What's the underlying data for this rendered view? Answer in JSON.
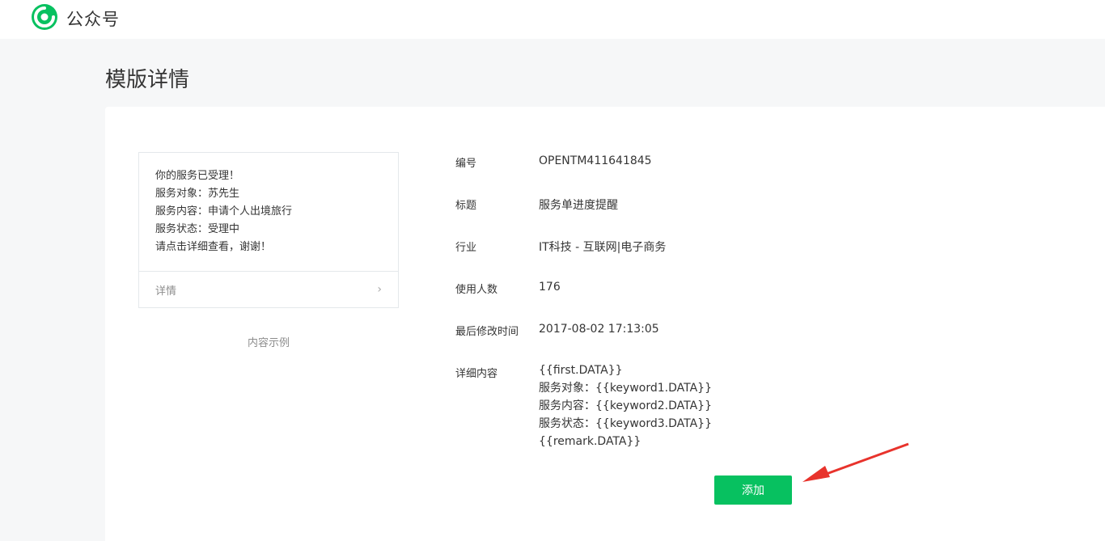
{
  "header": {
    "app_title": "公众号",
    "brand_color": "#07c160"
  },
  "page": {
    "title": "模版详情"
  },
  "sample": {
    "lines": [
      "你的服务已受理！",
      "服务对象：苏先生",
      "服务内容：申请个人出境旅行",
      "服务状态：受理中",
      "请点击详细查看，谢谢！"
    ],
    "detail_label": "详情",
    "chevron": "›",
    "caption": "内容示例"
  },
  "info": {
    "id_label": "编号",
    "id_value": "OPENTM411641845",
    "title_label": "标题",
    "title_value": "服务单进度提醒",
    "industry_label": "行业",
    "industry_value": "IT科技 - 互联网|电子商务",
    "users_label": "使用人数",
    "users_value": "176",
    "modified_label": "最后修改时间",
    "modified_value": "2017-08-02 17:13:05",
    "detail_label": "详细内容",
    "detail_lines": [
      "{{first.DATA}}",
      "服务对象：{{keyword1.DATA}}",
      "服务内容：{{keyword2.DATA}}",
      "服务状态：{{keyword3.DATA}}",
      "{{remark.DATA}}"
    ]
  },
  "actions": {
    "add_label": "添加",
    "arrow_color": "#e8332c"
  }
}
